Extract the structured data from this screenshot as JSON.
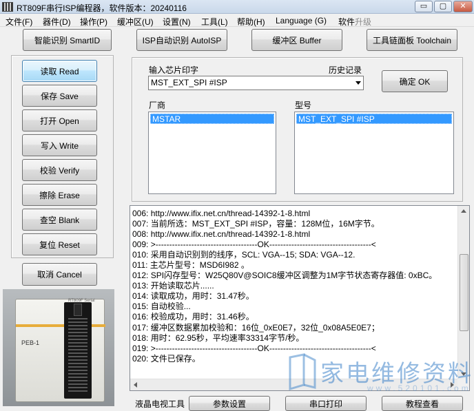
{
  "window": {
    "title": "RT809F串行ISP编程器，软件版本：20240116",
    "min_glyph": "▭",
    "max_glyph": "▢",
    "close_glyph": "✕"
  },
  "menu": [
    {
      "label": "文件(F)"
    },
    {
      "label": "器件(D)"
    },
    {
      "label": "操作(P)"
    },
    {
      "label": "缓冲区(U)"
    },
    {
      "label": "设置(N)"
    },
    {
      "label": "工具(L)"
    },
    {
      "label": "帮助(H)"
    },
    {
      "label": "Language (G)"
    },
    {
      "label": "软件",
      "faded": "升级"
    }
  ],
  "toolbar": {
    "smartid": "智能识别 SmartID",
    "autoisp": "ISP自动识别 AutoISP",
    "buffer": "缓冲区 Buffer",
    "toolchain": "工具链面板 Toolchain"
  },
  "actions": {
    "read": "读取 Read",
    "save": "保存 Save",
    "open": "打开 Open",
    "write": "写入 Write",
    "verify": "校验 Verify",
    "erase": "擦除 Erase",
    "blank": "查空 Blank",
    "reset": "复位 Reset",
    "cancel": "取消 Cancel"
  },
  "chip_panel": {
    "input_label": "输入芯片印字",
    "history_label": "历史记录",
    "chip_value": "MST_EXT_SPI #ISP",
    "ok_button": "确定 OK",
    "vendor_label": "厂商",
    "model_label": "型号",
    "vendor_selected": "MSTAR",
    "model_selected": "MST_EXT_SPI #ISP"
  },
  "device_photo": {
    "label": "PEB-1",
    "model": "RT809F Serial"
  },
  "log": [
    "006:  http://www.ifix.net.cn/thread-14392-1-8.html",
    "007:  当前所选：MST_EXT_SPI #ISP，容量：128M位，16M字节。",
    "008:  http://www.ifix.net.cn/thread-14392-1-8.html",
    "009:  >-------------------------------------OK-------------------------------------<",
    "010:  采用自动识别到的线序，SCL: VGA--15; SDA: VGA--12.",
    "011:  主芯片型号：MSD6I982 。",
    "012:  SPI闪存型号：W25Q80V@SOIC8缓冲区调整为1M字节状态寄存器值: 0xBC。",
    "013:  开始读取芯片......",
    "014:  读取成功，用时：31.47秒。",
    "015:  自动校验...",
    "016:  校验成功，用时：31.46秒。",
    "017:  缓冲区数据累加校验和：16位_0xE0E7，32位_0x08A5E0E7；",
    "018:  用时：62.95秒，平均速率33314字节/秒。",
    "019:  >-------------------------------------OK-------------------------------------<",
    "020:  文件已保存。"
  ],
  "footer": {
    "label": "液晶电视工具",
    "params": "参数设置",
    "serial": "串口打印",
    "tutorial": "教程查看"
  },
  "watermark": {
    "text": "家电维修资料",
    "url": "www.520101.com"
  }
}
